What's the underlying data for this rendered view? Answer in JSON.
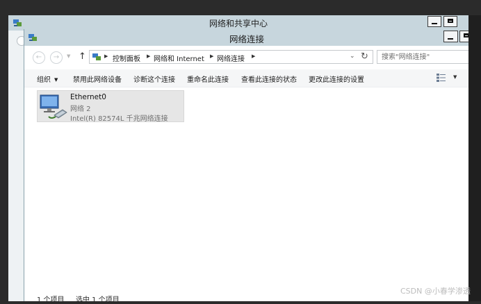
{
  "back_window": {
    "title": "网络和共享中心"
  },
  "window": {
    "title": "网络连接"
  },
  "address": {
    "crumbs": [
      "控制面板",
      "网络和 Internet",
      "网络连接"
    ],
    "search_placeholder": "搜索\"网络连接\""
  },
  "commands": [
    {
      "label": "组织"
    },
    {
      "label": "禁用此网络设备"
    },
    {
      "label": "诊断这个连接"
    },
    {
      "label": "重命名此连接"
    },
    {
      "label": "查看此连接的状态"
    },
    {
      "label": "更改此连接的设置"
    }
  ],
  "connections": [
    {
      "name": "Ethernet0",
      "network": "网络  2",
      "adapter": "Intel(R) 82574L 千兆网络连接"
    }
  ],
  "status": {
    "items_count": "1 个项目",
    "selected": "选中 1 个项目"
  },
  "watermark": "CSDN @小春学渗透",
  "colors": {
    "title_bar": "#c7d6dd",
    "selection": "#e6e6e6"
  }
}
